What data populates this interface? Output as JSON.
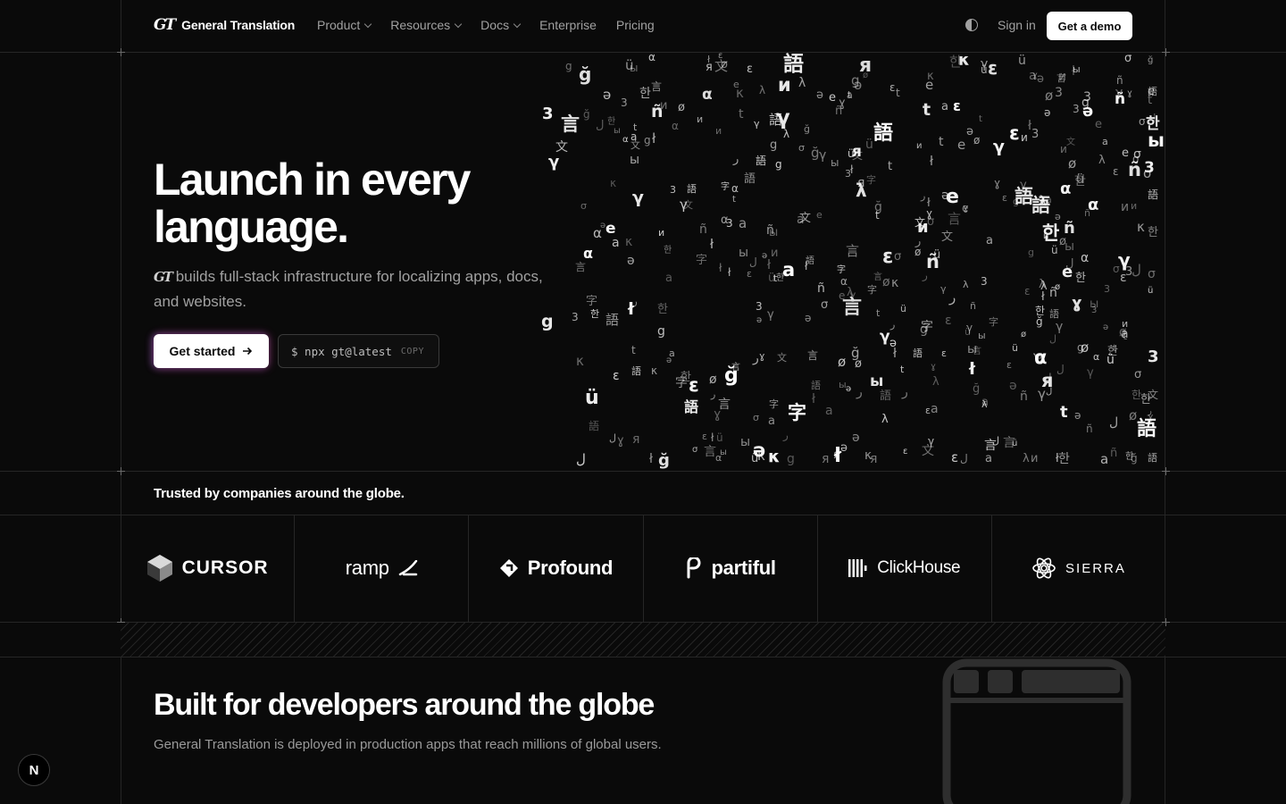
{
  "nav": {
    "logo_mark": "GT",
    "brand": "General Translation",
    "menu": [
      {
        "label": "Product",
        "dropdown": true
      },
      {
        "label": "Resources",
        "dropdown": true
      },
      {
        "label": "Docs",
        "dropdown": true
      },
      {
        "label": "Enterprise",
        "dropdown": false
      },
      {
        "label": "Pricing",
        "dropdown": false
      }
    ],
    "sign_in": "Sign in",
    "cta": "Get a demo"
  },
  "hero": {
    "title_line1": "Launch in every",
    "title_line2": "language.",
    "subtitle_mark": "GT",
    "subtitle": " builds full-stack infrastructure for localizing apps, docs, and websites.",
    "primary_button": "Get started",
    "command": "$ npx gt@latest",
    "copy_label": "COPY"
  },
  "glyph_chars": [
    "a",
    "語",
    "言",
    "字",
    "文",
    "한",
    "λ",
    "ы",
    "σ",
    "γ",
    "e",
    "g",
    "ə",
    "t",
    "ل",
    "ر",
    "α",
    "κ",
    "и",
    "я",
    "ε",
    "3",
    "ñ",
    "ɣ",
    "ü",
    "ğ",
    "ł",
    "ø"
  ],
  "trusted": {
    "heading": "Trusted by companies around the globe.",
    "companies": [
      "CURSOR",
      "ramp",
      "Profound",
      "partiful",
      "ClickHouse",
      "SIERRA"
    ]
  },
  "built": {
    "title": "Built for developers around the globe",
    "subtitle": "General Translation is deployed in production apps that reach millions of global users."
  },
  "next_badge": "N",
  "colors": {
    "background": "#0a0a0a",
    "border": "#262626",
    "muted_text": "#a1a1a1",
    "accent": "#ffffff"
  }
}
